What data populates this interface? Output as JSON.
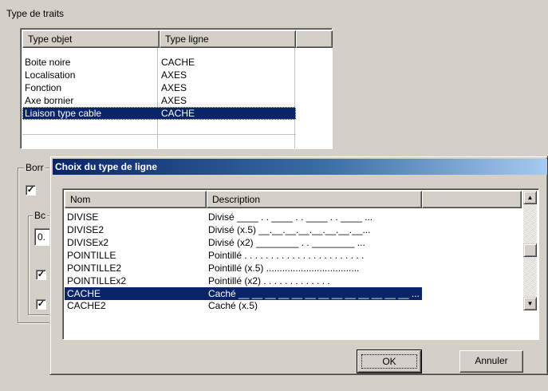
{
  "panel": {
    "section_label": "Type de traits",
    "columns": [
      "Type objet",
      "Type ligne"
    ],
    "rows": [
      {
        "type_objet": "Boite noire",
        "type_ligne": "CACHE",
        "selected": false
      },
      {
        "type_objet": "Localisation",
        "type_ligne": "AXES",
        "selected": false
      },
      {
        "type_objet": "Fonction",
        "type_ligne": "AXES",
        "selected": false
      },
      {
        "type_objet": "Axe bornier",
        "type_ligne": "AXES",
        "selected": false
      },
      {
        "type_objet": "Liaison type cable",
        "type_ligne": "CACHE",
        "selected": true
      }
    ],
    "group_label_truncated": "Borr",
    "subgroup_label_truncated": "Bc",
    "field_value_truncated": "0."
  },
  "dialog": {
    "title": "Choix du type de ligne",
    "columns": [
      "Nom",
      "Description"
    ],
    "rows": [
      {
        "nom": "DIVISE",
        "description": "Divisé ____ . . ____ . . ____ . . ____ ...",
        "selected": false
      },
      {
        "nom": "DIVISE2",
        "description": "Divisé (x.5) __.__.__.__.__.__.__.__...",
        "selected": false
      },
      {
        "nom": "DIVISEx2",
        "description": "Divisé (x2) ________  .  .  ________ ...",
        "selected": false
      },
      {
        "nom": "POINTILLE",
        "description": "Pointillé . . . . . . . . . . . . . . . . . . . . . . .",
        "selected": false
      },
      {
        "nom": "POINTILLE2",
        "description": "Pointillé (x.5) ...................................",
        "selected": false
      },
      {
        "nom": "POINTILLEx2",
        "description": "Pointillé (x2) .  .  .  .  .  .  .  .  .  .  .  .  .",
        "selected": false
      },
      {
        "nom": "CACHE",
        "description": "Caché __ __ __ __ __ __ __ __ __ __ __ __ __ ...",
        "selected": true
      },
      {
        "nom": "CACHE2",
        "description": "Caché (x.5)",
        "selected": false
      }
    ],
    "ok_label": "OK",
    "cancel_label": "Annuler"
  },
  "colors": {
    "selection": "#0a246a",
    "face": "#d4d0c8",
    "title_gradient_start": "#0a246a",
    "title_gradient_end": "#a6caf0"
  }
}
